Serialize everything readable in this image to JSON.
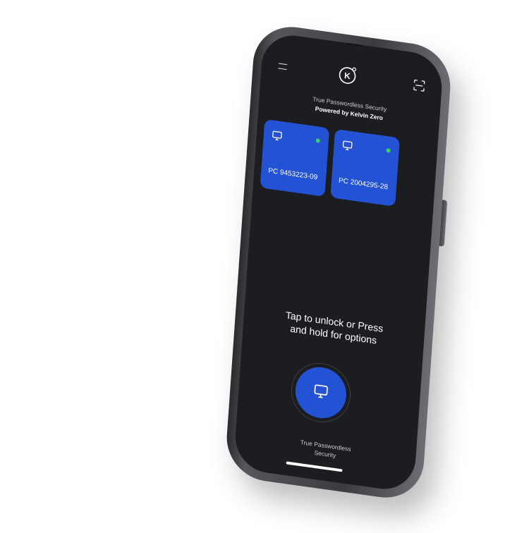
{
  "header": {
    "menu_icon": "menu-icon",
    "logo_icon": "kelvin-zero-logo",
    "logo_text": "K",
    "scan_icon": "scan-icon"
  },
  "tagline": "True Passwordless Security",
  "powered_by": "Powered by Kelvin Zero",
  "devices": [
    {
      "label": "PC 9453223-09",
      "icon": "monitor-icon",
      "status": "online"
    },
    {
      "label": "PC 2004295-28",
      "icon": "monitor-icon",
      "status": "online"
    }
  ],
  "prompt": {
    "line1": "Tap to unlock or Press",
    "line2": "and hold for options"
  },
  "unlock": {
    "icon": "monitor-icon",
    "caption_line1": "True Passwordless",
    "caption_line2": "Security"
  },
  "colors": {
    "screen_bg": "#1c1d20",
    "accent_blue": "#2452d4",
    "status_green": "#3ecf66",
    "text_primary": "#ffffff",
    "text_secondary": "#c9cacd"
  }
}
